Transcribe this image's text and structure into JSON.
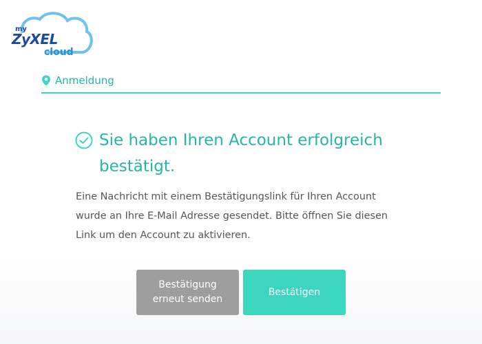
{
  "logo": {
    "prefix": "my",
    "brand": "ZyXEL",
    "suffix": "cloud"
  },
  "tab": {
    "label": "Anmeldung",
    "icon": "map-pin-icon"
  },
  "message": {
    "icon": "check-circle-icon",
    "heading": "Sie haben Ihren Account erfolgreich bestätigt.",
    "body": "Eine Nachricht mit einem Bestätigungslink für Ihren Account wurde an Ihre E-Mail Adresse gesendet. Bitte öffnen Sie diesen Link um den Account zu aktivieren."
  },
  "buttons": {
    "resend_label": "Bestätigung erneut senden",
    "confirm_label": "Bestätigen"
  },
  "colors": {
    "accent": "#3dd5be",
    "accent_text": "#27b6a1",
    "brand_blue": "#1e4a9e",
    "cloud_blue": "#2c8fd6",
    "button_gray": "#9e9e9e",
    "body_text": "#555555"
  }
}
